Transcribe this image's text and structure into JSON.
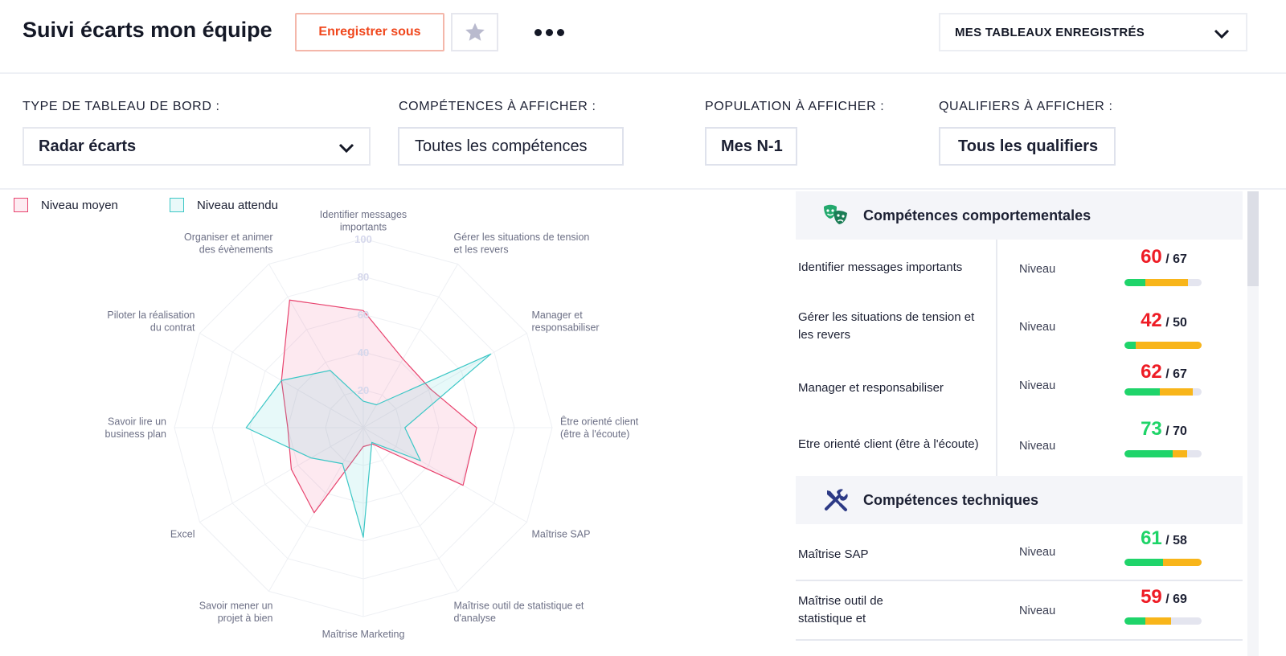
{
  "header": {
    "title": "Suivi écarts mon équipe",
    "save_as_label": "Enregistrer sous",
    "star_icon": "star-icon",
    "more_icon": "more-horizontal-icon",
    "saved_dashboards_label": "MES TABLEAUX ENREGISTRÉS"
  },
  "filters": {
    "dashboard_type": {
      "label": "TYPE DE TABLEAU DE BORD :",
      "value": "Radar écarts"
    },
    "skills": {
      "label": "COMPÉTENCES À AFFICHER :",
      "value": "Toutes les compétences"
    },
    "population": {
      "label": "POPULATION À AFFICHER :",
      "value": "Mes N-1"
    },
    "qualifiers": {
      "label": "QUALIFIERS À AFFICHER :",
      "value": "Tous les qualifiers"
    }
  },
  "legend": {
    "average": {
      "label": "Niveau moyen",
      "color": "#e8436e"
    },
    "expected": {
      "label": "Niveau attendu",
      "color": "#3cc7c6"
    }
  },
  "chart_data": {
    "type": "radar",
    "axes": [
      "Identifier messages importants",
      "Gérer les situations de tension et les revers",
      "Manager et responsabiliser",
      "Être orienté client (être à l'écoute)",
      "Maîtrise SAP",
      "Maîtrise outil de statistique et d'analyse",
      "Maîtrise Marketing",
      "Savoir mener un projet à bien",
      "Excel",
      "Savoir lire un business plan",
      "Piloter la réalisation du contrat",
      "Organiser et animer des évènements"
    ],
    "axis_label_lines": [
      [
        "Identifier messages",
        "importants"
      ],
      [
        "Gérer les situations de tension",
        "et les revers"
      ],
      [
        "Manager et",
        "responsabiliser"
      ],
      [
        "Être orienté client",
        "(être à l'écoute)"
      ],
      [
        "Maîtrise SAP"
      ],
      [
        "Maîtrise outil de statistique et",
        "d'analyse"
      ],
      [
        "Maîtrise Marketing"
      ],
      [
        "Savoir mener un",
        "projet à bien"
      ],
      [
        "Excel"
      ],
      [
        "Savoir lire un",
        "business plan"
      ],
      [
        "Piloter la réalisation",
        "du contrat"
      ],
      [
        "Organiser et animer",
        "des évènements"
      ]
    ],
    "ticks": [
      20,
      40,
      60,
      80,
      100
    ],
    "range": [
      0,
      100
    ],
    "series": [
      {
        "name": "Niveau moyen",
        "color": "#e8436e",
        "fill": "rgba(240,100,150,0.14)",
        "values": [
          62,
          42,
          41,
          60,
          61,
          10,
          10,
          52,
          44,
          40,
          50,
          78
        ]
      },
      {
        "name": "Niveau attendu",
        "color": "#3cc7c6",
        "fill": "rgba(70,205,205,0.13)",
        "values": [
          14,
          14,
          78,
          22,
          35,
          9,
          58,
          22,
          32,
          62,
          50,
          35
        ]
      }
    ]
  },
  "sections": [
    {
      "title": "Compétences comportementales",
      "icon": "theater-masks-icon",
      "skills": [
        {
          "name": "Identifier messages importants",
          "level_label": "Niveau",
          "score": "60",
          "target": "/ 67",
          "score_color": "#ee1c25",
          "green": 0.27,
          "orange": 0.55
        },
        {
          "name": "Gérer les situations de tension et les revers",
          "level_label": "Niveau",
          "score": "42",
          "target": "/ 50",
          "score_color": "#ee1c25",
          "green": 0.15,
          "orange": 0.85
        },
        {
          "name": "Manager et responsabiliser",
          "level_label": "Niveau",
          "score": "62",
          "target": "/ 67",
          "score_color": "#ee1c25",
          "green": 0.46,
          "orange": 0.43
        },
        {
          "name": "Etre orienté client (être à l'écoute)",
          "level_label": "Niveau",
          "score": "73",
          "target": "/ 70",
          "score_color": "#1ed468",
          "green": 0.63,
          "orange": 0.18
        }
      ]
    },
    {
      "title": "Compétences techniques",
      "icon": "tools-icon",
      "skills": [
        {
          "name": "Maîtrise SAP",
          "level_label": "Niveau",
          "score": "61",
          "target": "/ 58",
          "score_color": "#1ed468",
          "green": 0.5,
          "orange": 0.5
        },
        {
          "name": "Maîtrise outil de statistique et",
          "level_label": "Niveau",
          "score": "59",
          "target": "/ 69",
          "score_color": "#ee1c25",
          "green": 0.27,
          "orange": 0.33
        }
      ]
    }
  ]
}
